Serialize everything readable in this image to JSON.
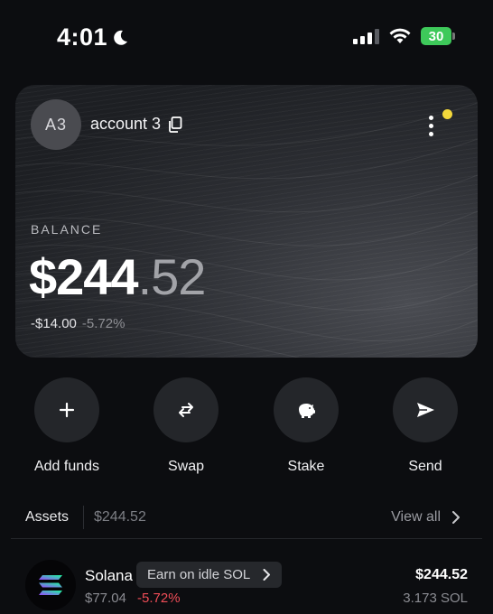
{
  "status_bar": {
    "time": "4:01",
    "battery": "30"
  },
  "account": {
    "avatar_initials": "A3",
    "name": "account 3"
  },
  "balance": {
    "label": "BALANCE",
    "whole": "$244",
    "cents": ".52",
    "change_amount": "-$14.00",
    "change_percent": "-5.72%"
  },
  "actions": [
    {
      "label": "Add funds",
      "icon": "plus-icon"
    },
    {
      "label": "Swap",
      "icon": "swap-arrows-icon"
    },
    {
      "label": "Stake",
      "icon": "piggy-bank-icon"
    },
    {
      "label": "Send",
      "icon": "send-icon"
    }
  ],
  "assets": {
    "title": "Assets",
    "total": "$244.52",
    "view_all": "View all",
    "items": [
      {
        "name": "Solana",
        "promo": "Earn on idle SOL",
        "price": "$77.04",
        "change": "-5.72%",
        "value": "$244.52",
        "amount": "3.173 SOL"
      }
    ]
  },
  "colors": {
    "background": "#0c0d10",
    "notification_dot": "#f3d83b",
    "negative": "#ef4d57",
    "battery": "#3ec95a"
  }
}
